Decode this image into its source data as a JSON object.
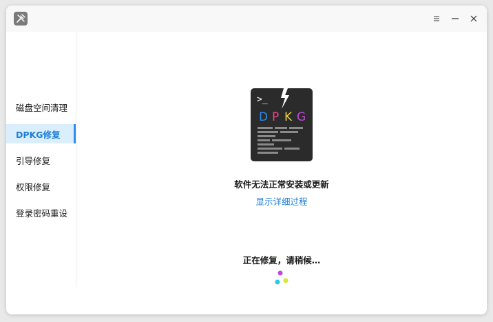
{
  "window": {
    "app_icon": "tools-icon",
    "controls": [
      "menu-icon",
      "minimize-icon",
      "close-icon"
    ]
  },
  "sidebar": {
    "items": [
      {
        "label": "磁盘空间清理",
        "active": false
      },
      {
        "label": "DPKG修复",
        "active": true
      },
      {
        "label": "引导修复",
        "active": false
      },
      {
        "label": "权限修复",
        "active": false
      },
      {
        "label": "登录密码重设",
        "active": false
      }
    ]
  },
  "main": {
    "icon": {
      "prompt": ">_",
      "letters": [
        "D",
        "P",
        "K",
        "G"
      ],
      "letter_colors": [
        "#2c8cf0",
        "#e84a8a",
        "#e8d23a",
        "#c04ad8"
      ]
    },
    "status_title": "软件无法正常安装或更新",
    "detail_link": "显示详细过程",
    "progress_text": "正在修复，请稍候…"
  },
  "colors": {
    "accent": "#1f7fd8",
    "active_bg": "#dbeefc"
  }
}
